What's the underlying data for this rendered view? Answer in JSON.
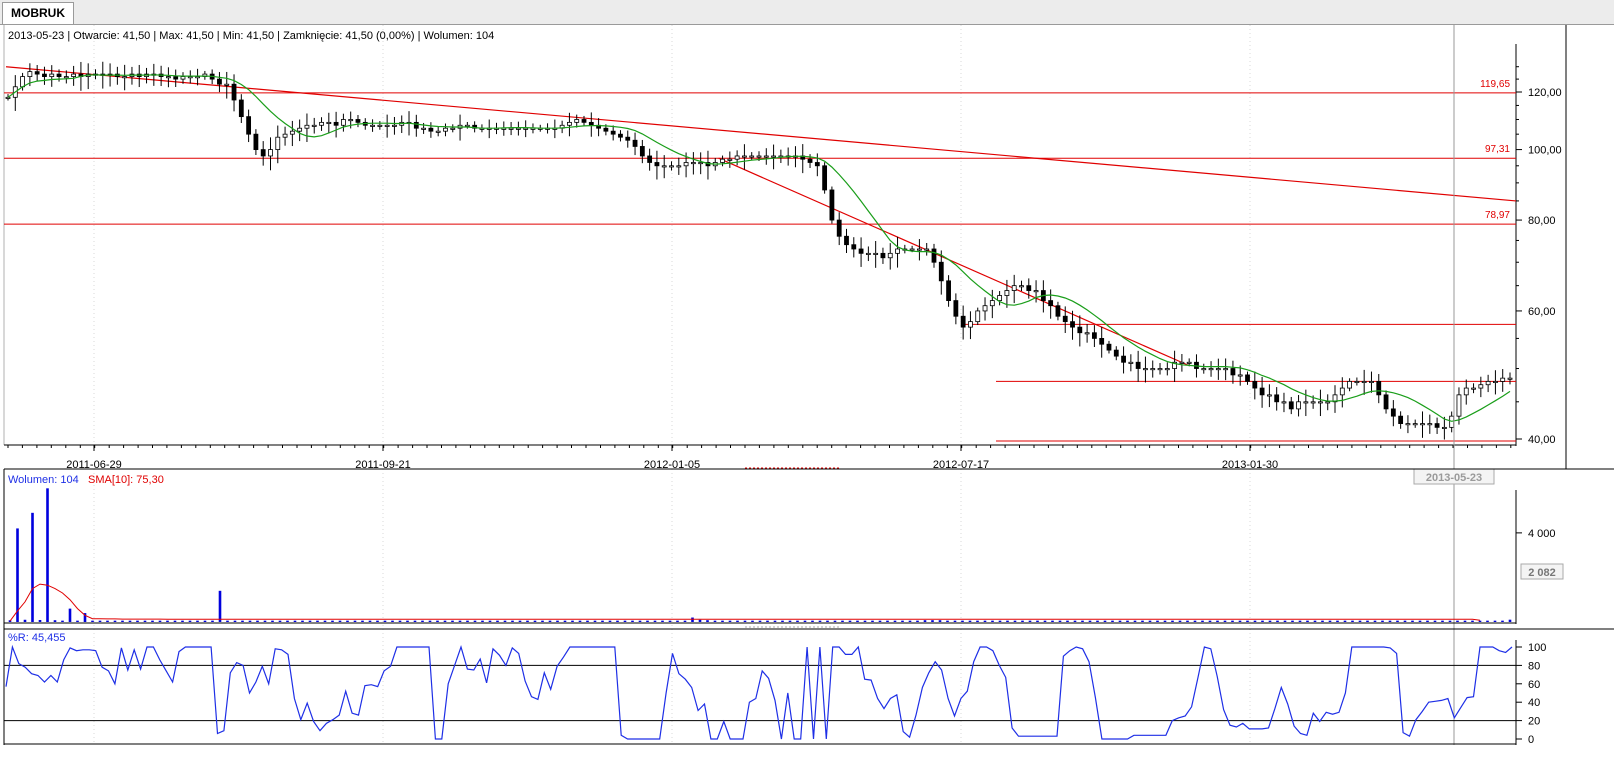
{
  "tab": {
    "title": "MOBRUK"
  },
  "info": {
    "date": "2013-05-23",
    "open": "Otwarcie: 41,50",
    "max": "Max: 41,50",
    "min": "Min: 41,50",
    "close": "Zamknięcie: 41,50 (0,00%)",
    "volume": "Wolumen: 104"
  },
  "volume_legend": {
    "volume": "Wolumen: 104",
    "sma": "SMA[10]: 75,30"
  },
  "wr_legend": {
    "label": "%R: 45,455"
  },
  "volume_badge": "2 082",
  "cursor_date": "2013-05-23",
  "colors": {
    "candle": "#000000",
    "sma": "#1a9e1a",
    "trend": "#e00000",
    "volume": "#0000dd",
    "volume_sma": "#e00000",
    "wr": "#1e2fe6"
  },
  "chart_data": [
    {
      "type": "candlestick",
      "x_tick_labels": [
        "2011-06-29",
        "2011-09-21",
        "2012-01-05",
        "2012-07-17",
        "2013-01-30"
      ],
      "y_tick_labels": [
        "40,00",
        "60,00",
        "80,00",
        "100,00",
        "120,00"
      ],
      "y_ticks": [
        40,
        60,
        80,
        100,
        120
      ],
      "y_scale": "log",
      "ylim": [
        40,
        133
      ],
      "horizontal_levels": [
        {
          "label": "119,65",
          "value": 119.65
        },
        {
          "label": "97,31",
          "value": 97.31
        },
        {
          "label": "78,97",
          "value": 78.97
        },
        {
          "value": 57.5
        },
        {
          "value": 48
        }
      ],
      "closes": [
        118,
        122,
        126,
        128,
        127,
        126,
        127,
        126,
        126,
        127,
        126,
        127,
        127,
        127,
        127,
        126,
        126,
        127,
        126,
        127,
        127,
        126,
        126,
        125,
        126,
        126,
        126,
        127,
        125,
        123,
        123,
        117,
        111,
        105,
        100,
        98,
        100,
        104,
        105,
        106,
        107,
        108,
        108,
        109,
        109,
        108,
        110,
        110,
        109,
        108,
        108,
        108,
        108,
        108,
        109,
        109,
        107,
        107,
        106,
        106,
        107,
        107,
        108,
        108,
        107,
        107,
        107,
        107,
        107,
        107,
        107,
        107,
        107,
        107,
        107,
        107,
        108,
        109,
        110,
        109,
        108,
        107,
        106,
        105,
        104,
        103,
        101,
        98,
        96,
        95,
        95,
        95,
        95,
        96,
        96,
        96,
        95,
        96,
        97,
        97,
        98,
        98,
        98,
        98,
        98,
        98,
        98,
        98,
        98,
        97,
        96,
        95,
        88,
        80,
        76,
        74,
        73,
        72,
        72,
        72,
        71,
        72,
        73,
        73,
        73,
        73,
        73,
        70,
        66,
        62,
        59,
        57,
        58,
        60,
        61,
        62,
        63,
        64,
        65,
        65,
        64,
        64,
        62,
        61,
        59,
        58,
        57,
        56,
        56,
        55,
        54,
        53,
        52,
        51,
        51,
        50,
        50,
        50,
        50,
        50,
        51,
        51,
        51,
        50,
        50,
        50,
        50,
        50,
        49,
        49,
        48,
        47,
        46,
        46,
        45,
        45,
        44,
        45,
        45,
        45,
        45,
        45,
        46,
        47,
        48,
        48,
        48,
        48,
        46,
        44,
        43,
        42,
        42,
        42,
        42,
        42,
        41.5,
        41.5,
        43,
        46,
        47,
        47,
        47.5,
        48,
        48,
        48.5,
        48.5
      ],
      "moving_average_label": "SMA",
      "trend_lines": [
        {
          "from": {
            "date": "2011-04-21",
            "value": 130
          },
          "to": {
            "date": "2013-06-13",
            "value": 85
          }
        },
        {
          "from": {
            "date": "2012-04-25",
            "value": 97.3
          },
          "to": {
            "date": "2012-12-25",
            "value": 50.5
          }
        }
      ]
    },
    {
      "type": "bar",
      "title": "Wolumen",
      "y_tick_labels": [
        "4 000"
      ],
      "ylim": [
        0,
        5700
      ],
      "values": [
        80,
        4200,
        100,
        4900,
        90,
        6000,
        80,
        60,
        600,
        60,
        400,
        60,
        60,
        60,
        60,
        60,
        60,
        60,
        60,
        60,
        60,
        60,
        60,
        60,
        60,
        60,
        60,
        60,
        1400,
        60,
        60,
        60,
        60,
        60,
        60,
        60,
        60,
        60,
        60,
        60,
        60,
        60,
        60,
        60,
        60,
        60,
        60,
        60,
        60,
        60,
        60,
        60,
        60,
        60,
        60,
        60,
        60,
        60,
        60,
        60,
        60,
        60,
        60,
        60,
        60,
        60,
        60,
        60,
        60,
        60,
        60,
        60,
        60,
        60,
        60,
        60,
        60,
        60,
        60,
        60,
        60,
        60,
        60,
        60,
        60,
        60,
        60,
        60,
        60,
        60,
        60,
        200,
        100,
        80,
        60,
        60,
        60,
        60,
        60,
        60,
        60,
        60,
        60,
        60,
        60,
        60,
        60,
        60,
        60,
        60,
        60,
        60,
        60,
        60,
        60,
        60,
        60,
        60,
        60,
        60,
        60,
        60,
        80,
        80,
        80,
        60,
        60,
        60,
        60,
        60,
        60,
        60,
        60,
        60,
        60,
        60,
        60,
        60,
        60,
        60,
        60,
        60,
        60,
        60,
        60,
        60,
        60,
        60,
        60,
        60,
        60,
        60,
        60,
        60,
        60,
        60,
        60,
        60,
        60,
        60,
        60,
        60,
        60,
        60,
        60,
        60,
        60,
        60,
        60,
        60,
        60,
        60,
        60,
        60,
        60,
        60,
        60,
        60,
        60,
        60,
        60,
        60,
        60,
        60,
        60,
        60,
        60,
        60,
        60,
        60,
        60,
        60,
        60,
        60,
        60,
        60,
        60,
        60,
        60,
        60,
        104
      ],
      "sma_values": [
        40,
        500,
        900,
        1500,
        1700,
        1650,
        1500,
        1300,
        1000,
        600,
        300,
        150,
        150,
        140,
        140,
        130,
        130,
        130,
        130,
        130,
        130,
        120,
        120,
        120,
        120,
        120,
        120,
        120,
        120,
        120,
        120,
        120,
        120,
        120,
        120,
        120,
        120,
        120,
        120,
        120,
        120,
        120,
        120,
        120,
        120,
        120,
        120,
        120,
        120,
        120,
        120,
        120,
        120,
        120,
        120,
        120,
        120,
        120,
        120,
        120,
        120,
        120,
        120,
        120,
        120,
        120,
        120,
        120,
        120,
        120,
        120,
        120,
        120,
        120,
        120,
        120,
        120,
        120,
        120,
        120,
        120,
        120,
        120,
        120,
        120,
        120,
        120,
        120,
        120,
        120,
        120,
        120,
        120,
        120,
        120,
        120,
        120,
        120,
        120,
        120,
        120,
        120,
        120,
        120,
        120,
        120,
        120,
        120,
        120,
        120,
        120,
        120,
        120,
        120,
        120,
        120,
        120,
        120,
        120,
        120,
        120,
        120,
        120,
        120,
        120,
        120,
        120,
        120,
        120,
        120,
        120,
        120,
        120,
        120,
        120,
        120,
        120,
        120,
        120,
        120,
        120,
        120,
        120,
        120,
        120,
        120,
        120,
        120,
        120,
        120,
        120,
        120,
        120,
        120,
        120,
        120,
        120,
        120,
        120,
        120,
        120,
        120,
        120,
        120,
        120,
        120,
        120,
        120,
        120,
        120,
        120,
        120,
        120,
        120,
        120,
        120,
        120,
        120,
        120,
        120,
        120,
        120,
        120,
        120,
        120,
        120,
        120,
        120,
        120,
        120,
        120,
        120,
        120,
        120,
        120,
        120,
        75
      ]
    },
    {
      "type": "line",
      "title": "%R",
      "y_tick_labels": [
        "0",
        "20",
        "40",
        "60",
        "80",
        "100"
      ],
      "y_ticks": [
        0,
        20,
        40,
        60,
        80,
        100
      ],
      "reference_levels": [
        20,
        80
      ],
      "ylim": [
        0,
        100
      ],
      "values": [
        57,
        100,
        82,
        78,
        71,
        69,
        62,
        69,
        62,
        86,
        99,
        96,
        97,
        97,
        96,
        78,
        74,
        60,
        99,
        75,
        97,
        76,
        100,
        100,
        86,
        74,
        62,
        95,
        100,
        100,
        100,
        100,
        100,
        6,
        9,
        72,
        83,
        80,
        50,
        62,
        79,
        60,
        98,
        97,
        92,
        44,
        21,
        39,
        19,
        9,
        17,
        21,
        26,
        52,
        28,
        26,
        58,
        59,
        57,
        74,
        79,
        100,
        100,
        100,
        100,
        100,
        100,
        0,
        0,
        60,
        80,
        100,
        76,
        75,
        87,
        61,
        98,
        91,
        80,
        99,
        93,
        63,
        46,
        43,
        72,
        54,
        79,
        89,
        100,
        100,
        100,
        100,
        100,
        100,
        100,
        100,
        4,
        0,
        0,
        0,
        0,
        0,
        0,
        50,
        93,
        71,
        65,
        56,
        31,
        38,
        0,
        0,
        19,
        0,
        0,
        0,
        40,
        44,
        74,
        66,
        42,
        0,
        50,
        0,
        0,
        100,
        0,
        100,
        0,
        100,
        100,
        92,
        92,
        100,
        65,
        64,
        44,
        33,
        44,
        48,
        8,
        2,
        26,
        56,
        72,
        84,
        75,
        44,
        25,
        44,
        52,
        84,
        100,
        100,
        96,
        80,
        67,
        12,
        3,
        3,
        3,
        3,
        3,
        3,
        3,
        90,
        96,
        100,
        98,
        84,
        45,
        0,
        0,
        0,
        0,
        0,
        4,
        4,
        4,
        4,
        4,
        4,
        20,
        23,
        25,
        35,
        67,
        100,
        98,
        68,
        32,
        15,
        13,
        17,
        11,
        11,
        11,
        12,
        33,
        56,
        38,
        14,
        6,
        4,
        28,
        19,
        29,
        27,
        29,
        50,
        100,
        100,
        100,
        100,
        100,
        100,
        99,
        93,
        7,
        3,
        21,
        30,
        40,
        41,
        42,
        44,
        23,
        34,
        45,
        46,
        100,
        100,
        100,
        96,
        94,
        100
      ],
      "current_value": "45,455"
    }
  ]
}
